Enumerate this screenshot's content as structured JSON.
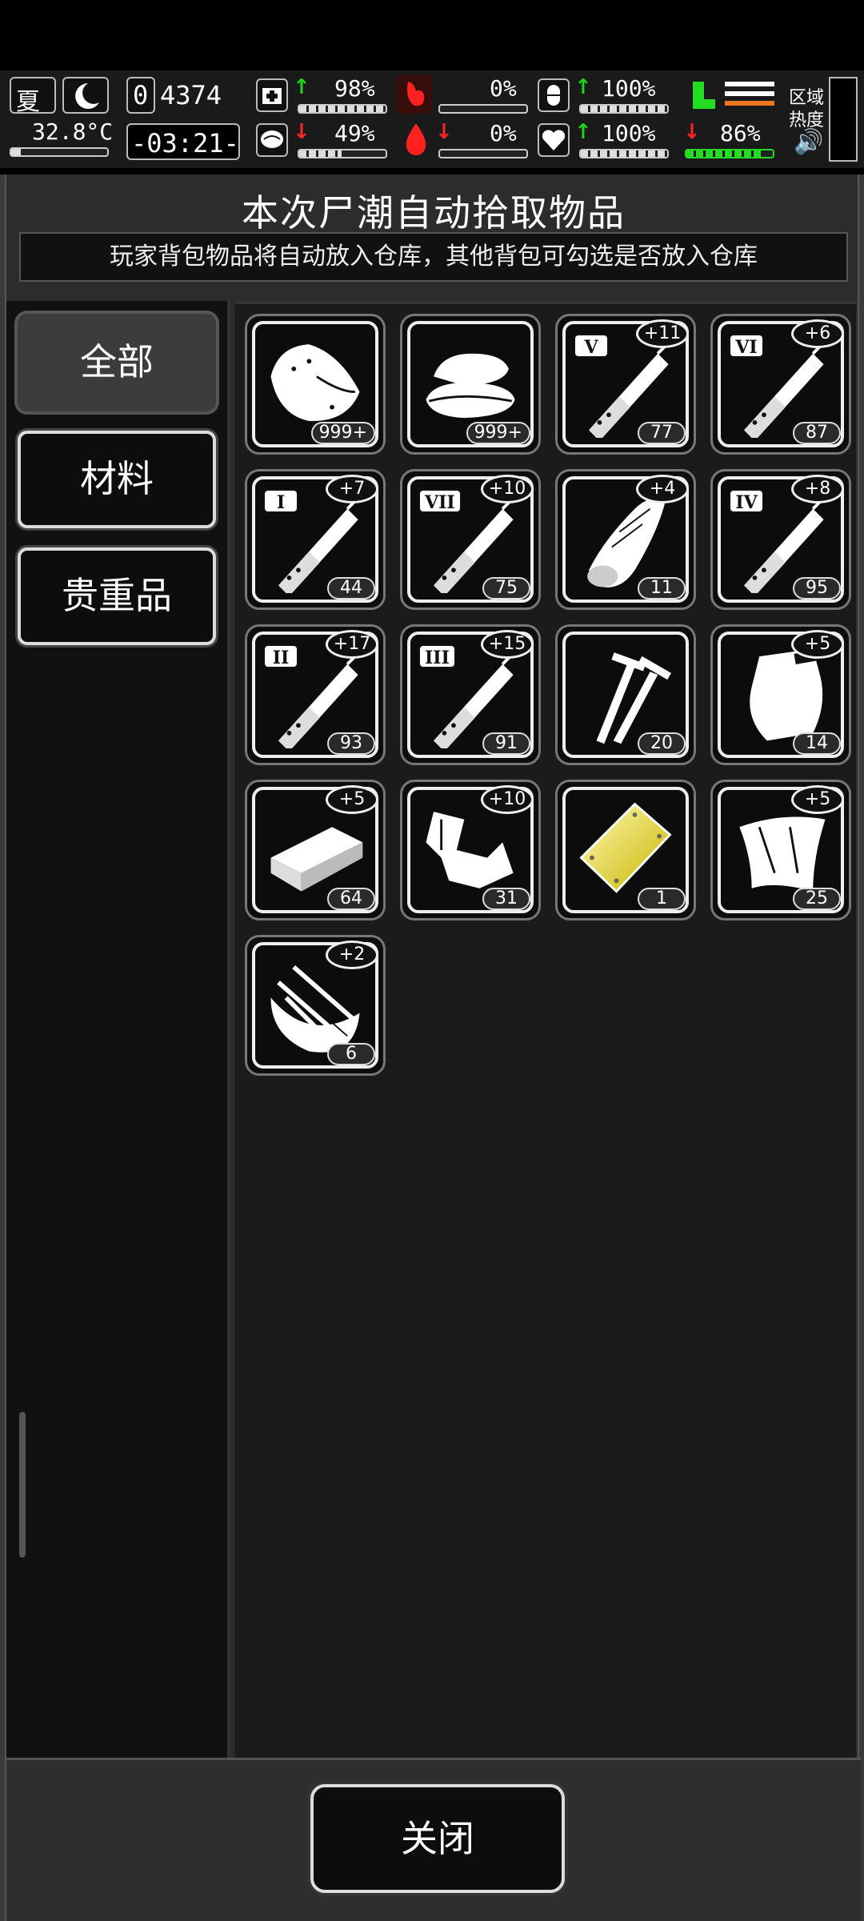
{
  "hud": {
    "season": "夏",
    "temperature": "32.8°C",
    "day_counter": "4374",
    "day_prefix": "0",
    "clock": "-03:21-",
    "stats": [
      {
        "name": "health",
        "value": "98%",
        "trend": "up",
        "fill": 0.98
      },
      {
        "name": "hunger",
        "value": "0%",
        "trend": "none",
        "fill": 0
      },
      {
        "name": "pills",
        "value": "100%",
        "trend": "up",
        "fill": 1.0
      },
      {
        "name": "mental",
        "value": "49%",
        "trend": "down",
        "fill": 0.49
      },
      {
        "name": "blood",
        "value": "0%",
        "trend": "down",
        "fill": 0
      },
      {
        "name": "heart",
        "value": "100%",
        "trend": "up",
        "fill": 1.0
      }
    ],
    "stamina": {
      "value": "86%",
      "trend": "down",
      "fill": 0.86
    },
    "zone_label_1": "区域",
    "zone_label_2": "热度",
    "colors": {
      "up": "#1dd21d",
      "down": "#ff2525",
      "stamina": "#22dd22",
      "orange": "#ee7722"
    }
  },
  "panel": {
    "title": "本次尸潮自动拾取物品",
    "subtitle": "玩家背包物品将自动放入仓库，其他背包可勾选是否放入仓库"
  },
  "sidebar": {
    "tabs": [
      {
        "label": "全部",
        "active": true
      },
      {
        "label": "材料",
        "active": false
      },
      {
        "label": "贵重品",
        "active": false
      }
    ]
  },
  "items": [
    {
      "icon": "meat-icon",
      "count": "999+",
      "plus": ""
    },
    {
      "icon": "cloth-icon",
      "count": "999+",
      "plus": ""
    },
    {
      "icon": "syringe-v-icon",
      "roman": "V",
      "count": "77",
      "plus": "+11"
    },
    {
      "icon": "syringe-vi-icon",
      "roman": "VI",
      "count": "87",
      "plus": "+6"
    },
    {
      "icon": "syringe-i-icon",
      "roman": "I",
      "count": "44",
      "plus": "+7"
    },
    {
      "icon": "syringe-vii-icon",
      "roman": "VII",
      "count": "75",
      "plus": "+10"
    },
    {
      "icon": "wood-log-icon",
      "count": "11",
      "plus": "+4"
    },
    {
      "icon": "syringe-iv-icon",
      "roman": "IV",
      "count": "95",
      "plus": "+8"
    },
    {
      "icon": "syringe-ii-icon",
      "roman": "II",
      "count": "93",
      "plus": "+17"
    },
    {
      "icon": "syringe-iii-icon",
      "roman": "III",
      "count": "91",
      "plus": "+15"
    },
    {
      "icon": "screws-icon",
      "count": "20",
      "plus": ""
    },
    {
      "icon": "plastic-bag-icon",
      "count": "14",
      "plus": "+5"
    },
    {
      "icon": "brick-icon",
      "count": "64",
      "plus": "+5"
    },
    {
      "icon": "scrap-metal-icon",
      "count": "31",
      "plus": "+10"
    },
    {
      "icon": "gold-plate-icon",
      "count": "1",
      "plus": ""
    },
    {
      "icon": "glass-shard-icon",
      "count": "25",
      "plus": "+5"
    },
    {
      "icon": "broken-bowl-icon",
      "count": "6",
      "plus": "+2"
    }
  ],
  "footer": {
    "close_label": "关闭"
  }
}
